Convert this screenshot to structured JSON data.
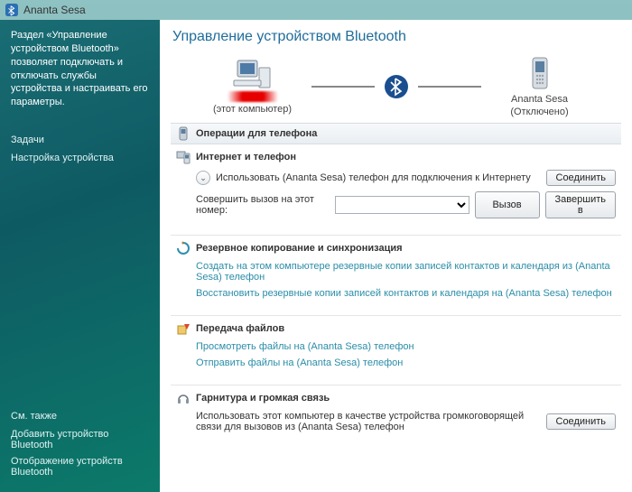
{
  "window": {
    "title": "Ananta Sesa"
  },
  "sidebar": {
    "intro": "Раздел «Управление устройством Bluetooth» позволяет подключать и отключать службы устройства и настраивать его параметры.",
    "tasks_header": "Задачи",
    "tasks": [
      {
        "label": "Настройка устройства"
      }
    ],
    "see_also_header": "См. также",
    "see_also": [
      {
        "label": "Добавить устройство Bluetooth"
      },
      {
        "label": "Отображение устройств Bluetooth"
      }
    ]
  },
  "page": {
    "title": "Управление устройством Bluetooth",
    "computer_label": "(этот компьютер)",
    "device_name": "Ananta Sesa",
    "device_status": "(Отключено)"
  },
  "ops": {
    "header": "Операции для телефона",
    "internet": {
      "title": "Интернет и телефон",
      "use_phone": "Использовать (Ananta Sesa) телефон для подключения к Интернету",
      "connect": "Соединить",
      "call_label": "Совершить вызов на этот номер:",
      "call_btn": "Вызов",
      "end_btn": "Завершить в"
    },
    "backup": {
      "title": "Резервное копирование и синхронизация",
      "create": "Создать на этом компьютере резервные копии записей контактов и календаря из (Ananta Sesa) телефон",
      "restore": "Восстановить резервные копии записей контактов и календаря на (Ananta Sesa) телефон"
    },
    "files": {
      "title": "Передача файлов",
      "browse": "Просмотреть файлы на (Ananta Sesa) телефон",
      "send": "Отправить файлы на (Ananta Sesa) телефон"
    },
    "headset": {
      "title": "Гарнитура и громкая связь",
      "use": "Использовать этот компьютер в качестве устройства громкоговорящей связи для вызовов из (Ananta Sesa) телефон",
      "connect": "Соединить"
    }
  }
}
